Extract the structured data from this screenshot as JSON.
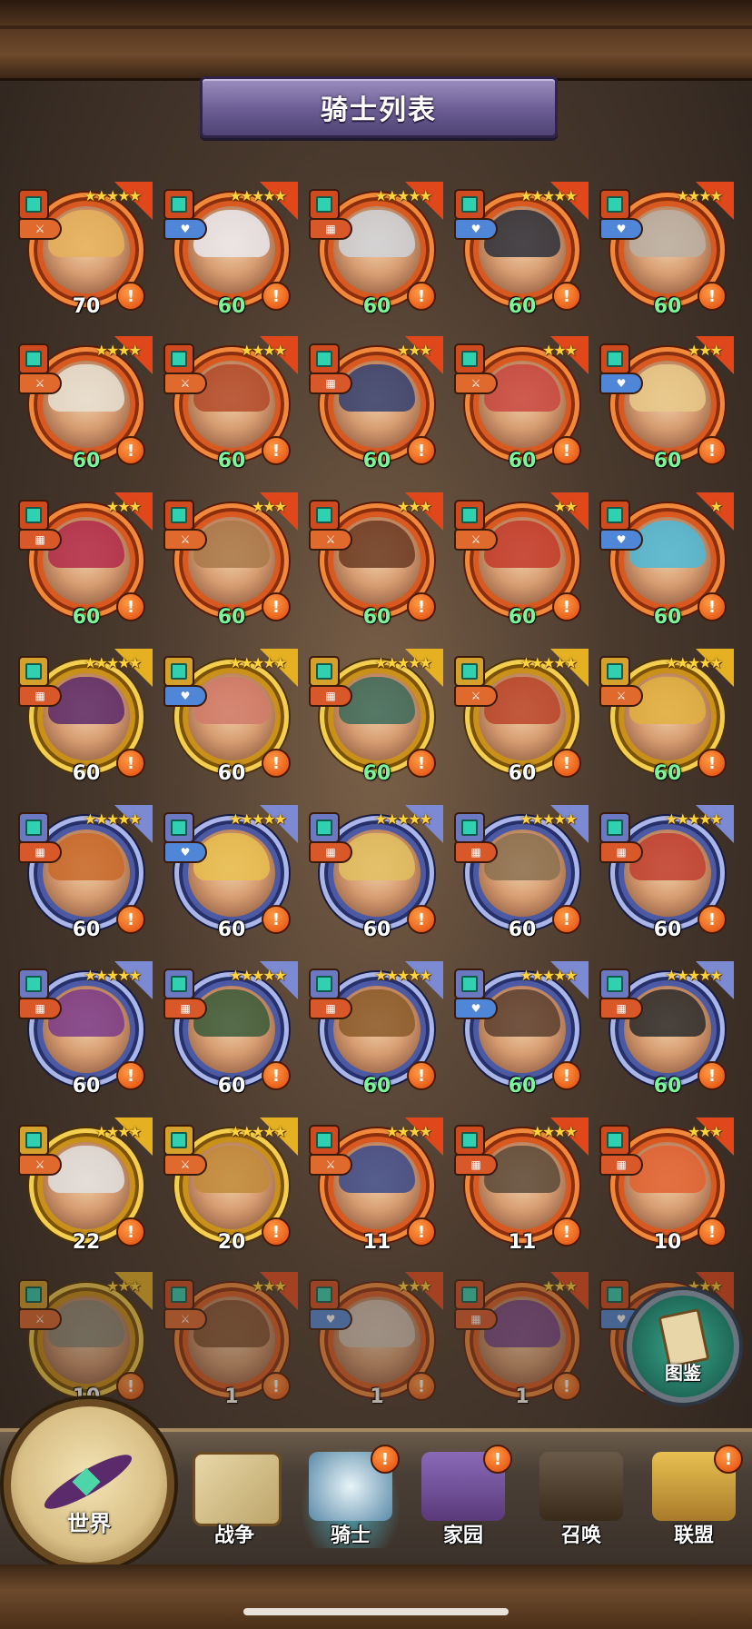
{
  "title": "骑士列表",
  "knights": [
    {
      "level": "70",
      "stars": "★★★★★",
      "rarity": "orange",
      "role": "sword",
      "hair": "#e5b15c",
      "green": false
    },
    {
      "level": "60",
      "stars": "★★★★★",
      "rarity": "orange",
      "role": "heart",
      "hair": "#e9e9ef",
      "green": true
    },
    {
      "level": "60",
      "stars": "★★★★★",
      "rarity": "orange",
      "role": "shield",
      "hair": "#cfd3da",
      "green": true
    },
    {
      "level": "60",
      "stars": "★★★★★",
      "rarity": "orange",
      "role": "heart",
      "hair": "#2b2f3a",
      "green": true
    },
    {
      "level": "60",
      "stars": "★★★★",
      "rarity": "orange",
      "role": "heart",
      "hair": "#b8b0a6",
      "green": true
    },
    {
      "level": "60",
      "stars": "★★★★",
      "rarity": "orange",
      "role": "sword",
      "hair": "#e6e0d4",
      "green": true
    },
    {
      "level": "60",
      "stars": "★★★★",
      "rarity": "orange",
      "role": "sword",
      "hair": "#b24a2a",
      "green": true
    },
    {
      "level": "60",
      "stars": "★★★",
      "rarity": "orange",
      "role": "shield",
      "hair": "#324070",
      "green": true
    },
    {
      "level": "60",
      "stars": "★★★",
      "rarity": "orange",
      "role": "sword",
      "hair": "#c8473f",
      "green": true
    },
    {
      "level": "60",
      "stars": "★★★",
      "rarity": "orange",
      "role": "heart",
      "hair": "#e8c98a",
      "green": true
    },
    {
      "level": "60",
      "stars": "★★★",
      "rarity": "orange",
      "role": "shield",
      "hair": "#b02a4a",
      "green": true
    },
    {
      "level": "60",
      "stars": "★★★",
      "rarity": "orange",
      "role": "sword",
      "hair": "#a8784a",
      "green": true
    },
    {
      "level": "60",
      "stars": "★★★",
      "rarity": "orange",
      "role": "sword",
      "hair": "#6a3a22",
      "green": true
    },
    {
      "level": "60",
      "stars": "★★",
      "rarity": "orange",
      "role": "sword",
      "hair": "#c23a2a",
      "green": true
    },
    {
      "level": "60",
      "stars": "★",
      "rarity": "orange",
      "role": "heart",
      "hair": "#4ab8d8",
      "green": true
    },
    {
      "level": "60",
      "stars": "★★★★★",
      "rarity": "gold",
      "role": "shield",
      "hair": "#5a2a6a",
      "green": false
    },
    {
      "level": "60",
      "stars": "★★★★★",
      "rarity": "gold",
      "role": "heart",
      "hair": "#d07a6a",
      "green": false
    },
    {
      "level": "60",
      "stars": "★★★★★",
      "rarity": "gold",
      "role": "shield",
      "hair": "#3a6a5a",
      "green": true
    },
    {
      "level": "60",
      "stars": "★★★★★",
      "rarity": "gold",
      "role": "sword",
      "hair": "#b8442a",
      "green": false
    },
    {
      "level": "60",
      "stars": "★★★★★",
      "rarity": "gold",
      "role": "sword",
      "hair": "#e0b040",
      "green": true
    },
    {
      "level": "60",
      "stars": "★★★★★",
      "rarity": "purple",
      "role": "shield",
      "hair": "#c8682a",
      "green": false
    },
    {
      "level": "60",
      "stars": "★★★★★",
      "rarity": "purple",
      "role": "heart",
      "hair": "#e8c050",
      "green": false
    },
    {
      "level": "60",
      "stars": "★★★★★",
      "rarity": "purple",
      "role": "shield",
      "hair": "#e0c060",
      "green": false
    },
    {
      "level": "60",
      "stars": "★★★★★",
      "rarity": "purple",
      "role": "shield",
      "hair": "#8a7050",
      "green": false
    },
    {
      "level": "60",
      "stars": "★★★★★",
      "rarity": "purple",
      "role": "shield",
      "hair": "#c04030",
      "green": false
    },
    {
      "level": "60",
      "stars": "★★★★★",
      "rarity": "purple",
      "role": "shield",
      "hair": "#7a3a8a",
      "green": false
    },
    {
      "level": "60",
      "stars": "★★★★★",
      "rarity": "purple",
      "role": "shield",
      "hair": "#3a5a3a",
      "green": false
    },
    {
      "level": "60",
      "stars": "★★★★★",
      "rarity": "purple",
      "role": "shield",
      "hair": "#8a5a2a",
      "green": true
    },
    {
      "level": "60",
      "stars": "★★★★★",
      "rarity": "purple",
      "role": "heart",
      "hair": "#5a4030",
      "green": true
    },
    {
      "level": "60",
      "stars": "★★★★★",
      "rarity": "purple",
      "role": "shield",
      "hair": "#2a2a2a",
      "green": true
    },
    {
      "level": "22",
      "stars": "★★★★",
      "rarity": "gold",
      "role": "sword",
      "hair": "#e0e0e0",
      "green": false
    },
    {
      "level": "20",
      "stars": "★★★★★",
      "rarity": "gold",
      "role": "sword",
      "hair": "#c08a3a",
      "green": false
    },
    {
      "level": "11",
      "stars": "★★★★",
      "rarity": "orange",
      "role": "sword",
      "hair": "#3a4a8a",
      "green": false
    },
    {
      "level": "11",
      "stars": "★★★★",
      "rarity": "orange",
      "role": "shield",
      "hair": "#5a4a3a",
      "green": false
    },
    {
      "level": "10",
      "stars": "★★★",
      "rarity": "orange",
      "role": "shield",
      "hair": "#e06030",
      "green": false
    },
    {
      "level": "10",
      "stars": "★★★",
      "rarity": "gold",
      "role": "sword",
      "hair": "#8a8a7a",
      "green": false
    },
    {
      "level": "1",
      "stars": "★★★",
      "rarity": "orange",
      "role": "sword",
      "hair": "#7a4a2a",
      "green": false
    },
    {
      "level": "1",
      "stars": "★★★",
      "rarity": "orange",
      "role": "heart",
      "hair": "#d0c8c0",
      "green": false
    },
    {
      "level": "1",
      "stars": "★★★",
      "rarity": "orange",
      "role": "shield",
      "hair": "#6a3a8a",
      "green": false
    },
    {
      "level": "",
      "stars": "★★★",
      "rarity": "orange",
      "role": "heart",
      "hair": "#5a6a5a",
      "green": false
    }
  ],
  "encyclopedia_label": "图鉴",
  "nav": {
    "world": "世界",
    "war": "战争",
    "knight": "骑士",
    "home": "家园",
    "summon": "召唤",
    "alliance": "联盟"
  },
  "alert_mark": "!",
  "role_glyphs": {
    "sword": "⚔",
    "heart": "♥",
    "shield": "▦"
  }
}
